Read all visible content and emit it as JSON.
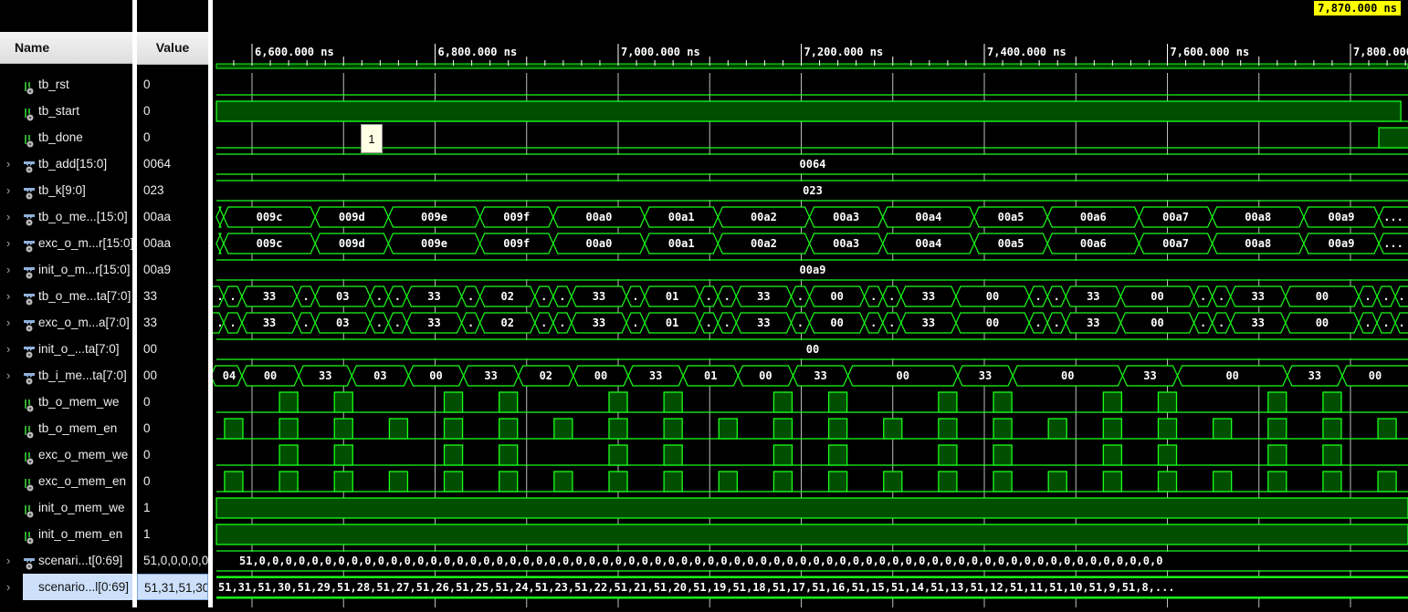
{
  "headers": {
    "name": "Name",
    "value": "Value"
  },
  "cursor_time": "7,870.000 ns",
  "marker_label": "1",
  "colors": {
    "wave": "#19ff19",
    "fill": "#004f00",
    "grid": "#bdbdbd",
    "cursor_bg": "#ffff00",
    "selection": "#cde0fb"
  },
  "timeline": {
    "unit": "ns",
    "labels": [
      {
        "t": 6600,
        "text": "6,600.000 ns"
      },
      {
        "t": 6800,
        "text": "6,800.000 ns"
      },
      {
        "t": 7000,
        "text": "7,000.000 ns"
      },
      {
        "t": 7200,
        "text": "7,200.000 ns"
      },
      {
        "t": 7400,
        "text": "7,400.000 ns"
      },
      {
        "t": 7600,
        "text": "7,600.000 ns"
      },
      {
        "t": 7800,
        "text": "7,800.000 ns"
      }
    ]
  },
  "signals": [
    {
      "name": "tb_rst",
      "value": "0",
      "kind": "bit",
      "icon": "bit-signal-icon",
      "wave": {
        "const": 0
      }
    },
    {
      "name": "tb_start",
      "value": "0",
      "kind": "bit",
      "icon": "bit-signal-icon",
      "wave": {
        "high": [
          [
            6561,
            7855
          ]
        ]
      }
    },
    {
      "name": "tb_done",
      "value": "0",
      "kind": "bit",
      "icon": "bit-signal-icon",
      "wave": {
        "high": [
          [
            7831,
            7900
          ]
        ]
      }
    },
    {
      "name": "tb_add[15:0]",
      "value": "0064",
      "kind": "bus",
      "icon": "bus-signal-icon",
      "wave": {
        "const_label": "0064"
      }
    },
    {
      "name": "tb_k[9:0]",
      "value": "023",
      "kind": "bus",
      "icon": "bus-signal-icon",
      "wave": {
        "const_label": "023"
      }
    },
    {
      "name": "tb_o_me...[15:0]",
      "value": "00aa",
      "kind": "bus",
      "icon": "bus-signal-icon",
      "wave": {
        "segments": [
          [
            6561,
            ""
          ],
          [
            6569,
            "009c"
          ],
          [
            6669,
            "009d"
          ],
          [
            6749,
            "009e"
          ],
          [
            6849,
            "009f"
          ],
          [
            6929,
            "00a0"
          ],
          [
            7029,
            "00a1"
          ],
          [
            7109,
            "00a2"
          ],
          [
            7209,
            "00a3"
          ],
          [
            7289,
            "00a4"
          ],
          [
            7389,
            "00a5"
          ],
          [
            7469,
            "00a6"
          ],
          [
            7569,
            "00a7"
          ],
          [
            7649,
            "00a8"
          ],
          [
            7749,
            "00a9"
          ],
          [
            7831,
            "..."
          ]
        ]
      }
    },
    {
      "name": "exc_o_m...r[15:0]",
      "value": "00aa",
      "kind": "bus",
      "icon": "bus-signal-icon",
      "wave": {
        "segments": [
          [
            6561,
            ""
          ],
          [
            6569,
            "009c"
          ],
          [
            6669,
            "009d"
          ],
          [
            6749,
            "009e"
          ],
          [
            6849,
            "009f"
          ],
          [
            6929,
            "00a0"
          ],
          [
            7029,
            "00a1"
          ],
          [
            7109,
            "00a2"
          ],
          [
            7209,
            "00a3"
          ],
          [
            7289,
            "00a4"
          ],
          [
            7389,
            "00a5"
          ],
          [
            7469,
            "00a6"
          ],
          [
            7569,
            "00a7"
          ],
          [
            7649,
            "00a8"
          ],
          [
            7749,
            "00a9"
          ],
          [
            7831,
            "..."
          ]
        ]
      }
    },
    {
      "name": "init_o_m...r[15:0]",
      "value": "00a9",
      "kind": "bus",
      "icon": "bus-signal-icon",
      "wave": {
        "const_label": "00a9"
      }
    },
    {
      "name": "tb_o_me...ta[7:0]",
      "value": "33",
      "kind": "bus",
      "icon": "bus-signal-icon",
      "wave": {
        "segments": [
          [
            6549,
            "."
          ],
          [
            6569,
            "."
          ],
          [
            6589,
            "33"
          ],
          [
            6649,
            "."
          ],
          [
            6669,
            "03"
          ],
          [
            6729,
            "."
          ],
          [
            6749,
            "."
          ],
          [
            6769,
            "33"
          ],
          [
            6829,
            "."
          ],
          [
            6849,
            "02"
          ],
          [
            6909,
            "."
          ],
          [
            6929,
            "."
          ],
          [
            6949,
            "33"
          ],
          [
            7009,
            "."
          ],
          [
            7029,
            "01"
          ],
          [
            7089,
            "."
          ],
          [
            7109,
            "."
          ],
          [
            7129,
            "33"
          ],
          [
            7189,
            "."
          ],
          [
            7209,
            "00"
          ],
          [
            7269,
            "."
          ],
          [
            7289,
            "."
          ],
          [
            7309,
            "33"
          ],
          [
            7369,
            "00"
          ],
          [
            7449,
            "."
          ],
          [
            7469,
            "."
          ],
          [
            7489,
            "33"
          ],
          [
            7549,
            "00"
          ],
          [
            7629,
            "."
          ],
          [
            7649,
            "."
          ],
          [
            7669,
            "33"
          ],
          [
            7729,
            "00"
          ],
          [
            7809,
            "."
          ],
          [
            7829,
            "."
          ],
          [
            7849,
            "."
          ]
        ]
      }
    },
    {
      "name": "exc_o_m...a[7:0]",
      "value": "33",
      "kind": "bus",
      "icon": "bus-signal-icon",
      "wave": {
        "segments": [
          [
            6549,
            "."
          ],
          [
            6569,
            "."
          ],
          [
            6589,
            "33"
          ],
          [
            6649,
            "."
          ],
          [
            6669,
            "03"
          ],
          [
            6729,
            "."
          ],
          [
            6749,
            "."
          ],
          [
            6769,
            "33"
          ],
          [
            6829,
            "."
          ],
          [
            6849,
            "02"
          ],
          [
            6909,
            "."
          ],
          [
            6929,
            "."
          ],
          [
            6949,
            "33"
          ],
          [
            7009,
            "."
          ],
          [
            7029,
            "01"
          ],
          [
            7089,
            "."
          ],
          [
            7109,
            "."
          ],
          [
            7129,
            "33"
          ],
          [
            7189,
            "."
          ],
          [
            7209,
            "00"
          ],
          [
            7269,
            "."
          ],
          [
            7289,
            "."
          ],
          [
            7309,
            "33"
          ],
          [
            7369,
            "00"
          ],
          [
            7449,
            "."
          ],
          [
            7469,
            "."
          ],
          [
            7489,
            "33"
          ],
          [
            7549,
            "00"
          ],
          [
            7629,
            "."
          ],
          [
            7649,
            "."
          ],
          [
            7669,
            "33"
          ],
          [
            7729,
            "00"
          ],
          [
            7809,
            "."
          ],
          [
            7829,
            "."
          ],
          [
            7849,
            "."
          ]
        ]
      }
    },
    {
      "name": "init_o_...ta[7:0]",
      "value": "00",
      "kind": "bus",
      "icon": "bus-signal-icon",
      "wave": {
        "const_label": "00"
      }
    },
    {
      "name": "tb_i_me...ta[7:0]",
      "value": "00",
      "kind": "bus",
      "icon": "bus-signal-icon",
      "wave": {
        "segments": [
          [
            6555,
            "04"
          ],
          [
            6589,
            "00"
          ],
          [
            6651,
            "33"
          ],
          [
            6709,
            "03"
          ],
          [
            6771,
            "00"
          ],
          [
            6831,
            "33"
          ],
          [
            6891,
            "02"
          ],
          [
            6951,
            "00"
          ],
          [
            7011,
            "33"
          ],
          [
            7071,
            "01"
          ],
          [
            7131,
            "00"
          ],
          [
            7191,
            "33"
          ],
          [
            7251,
            "00"
          ],
          [
            7371,
            "33"
          ],
          [
            7431,
            "00"
          ],
          [
            7551,
            "33"
          ],
          [
            7611,
            "00"
          ],
          [
            7731,
            "33"
          ],
          [
            7791,
            "00"
          ]
        ]
      }
    },
    {
      "name": "tb_o_mem_we",
      "value": "0",
      "kind": "bit",
      "icon": "bit-signal-icon",
      "wave": {
        "pulse_width": 20,
        "rises": [
          6630,
          6690,
          6810,
          6870,
          6990,
          7050,
          7170,
          7230,
          7350,
          7410,
          7530,
          7590,
          7710,
          7770
        ]
      }
    },
    {
      "name": "tb_o_mem_en",
      "value": "0",
      "kind": "bit",
      "icon": "bit-signal-icon",
      "wave": {
        "pulse_width": 20,
        "rises": [
          6570,
          6630,
          6690,
          6750,
          6810,
          6870,
          6930,
          6990,
          7050,
          7110,
          7170,
          7230,
          7290,
          7350,
          7410,
          7470,
          7530,
          7590,
          7650,
          7710,
          7770,
          7830
        ]
      }
    },
    {
      "name": "exc_o_mem_we",
      "value": "0",
      "kind": "bit",
      "icon": "bit-signal-icon",
      "wave": {
        "pulse_width": 20,
        "rises": [
          6630,
          6690,
          6810,
          6870,
          6990,
          7050,
          7170,
          7230,
          7350,
          7410,
          7530,
          7590,
          7710,
          7770
        ]
      }
    },
    {
      "name": "exc_o_mem_en",
      "value": "0",
      "kind": "bit",
      "icon": "bit-signal-icon",
      "wave": {
        "pulse_width": 20,
        "rises": [
          6570,
          6630,
          6690,
          6750,
          6810,
          6870,
          6930,
          6990,
          7050,
          7110,
          7170,
          7230,
          7290,
          7350,
          7410,
          7470,
          7530,
          7590,
          7650,
          7710,
          7770,
          7830
        ]
      }
    },
    {
      "name": "init_o_mem_we",
      "value": "1",
      "kind": "bit",
      "icon": "bit-signal-icon",
      "wave": {
        "const": 1
      }
    },
    {
      "name": "init_o_mem_en",
      "value": "1",
      "kind": "bit",
      "icon": "bit-signal-icon",
      "wave": {
        "const": 1
      }
    },
    {
      "name": "scenari...t[0:69]",
      "value": "51,0,0,0,0,0",
      "kind": "bus",
      "icon": "bus-signal-icon",
      "wave": {
        "const_label": "51,0,0,0,0,0,0,0,0,0,0,0,0,0,0,0,0,0,0,0,0,0,0,0,0,0,0,0,0,0,0,0,0,0,0,0,0,0,0,0,0,0,0,0,0,0,0,0,0,0,0,0,0,0,0,0,0,0,0,0,0,0,0,0,0,0,0,0,0,0",
        "align": "left"
      }
    },
    {
      "name": "scenario...l[0:69]",
      "value": "51,31,51,30",
      "kind": "bus",
      "icon": "bus-signal-icon",
      "selected": true,
      "wave": {
        "const_label": "51,31,51,30,51,29,51,28,51,27,51,26,51,25,51,24,51,23,51,22,51,21,51,20,51,19,51,18,51,17,51,16,51,15,51,14,51,13,51,12,51,11,51,10,51,9,51,8,...",
        "align": "left"
      }
    }
  ]
}
